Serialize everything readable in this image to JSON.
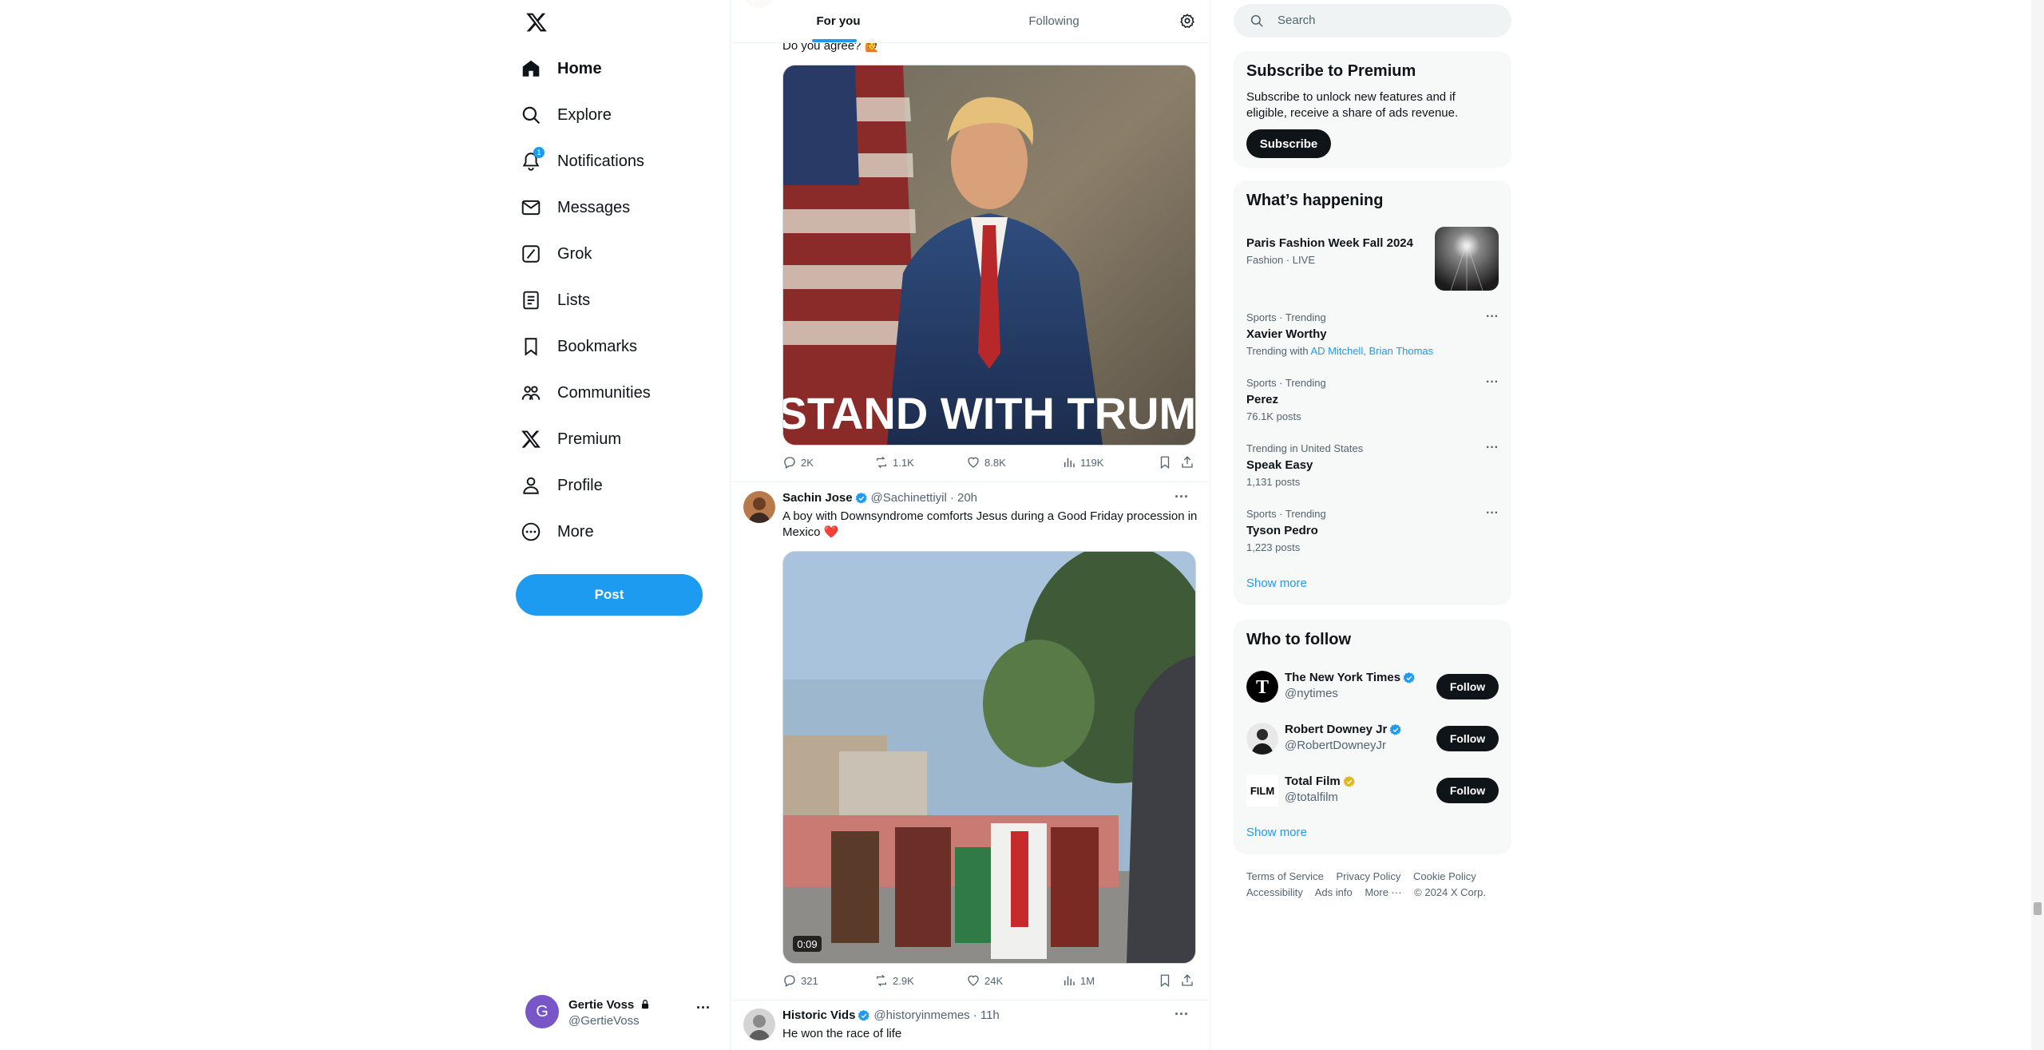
{
  "nav": {
    "items": [
      {
        "label": "Home",
        "icon": "home-icon",
        "active": true
      },
      {
        "label": "Explore",
        "icon": "search-icon"
      },
      {
        "label": "Notifications",
        "icon": "bell-icon",
        "badge": "1"
      },
      {
        "label": "Messages",
        "icon": "envelope-icon"
      },
      {
        "label": "Grok",
        "icon": "grok-icon"
      },
      {
        "label": "Lists",
        "icon": "list-icon"
      },
      {
        "label": "Bookmarks",
        "icon": "bookmark-icon"
      },
      {
        "label": "Communities",
        "icon": "communities-icon"
      },
      {
        "label": "Premium",
        "icon": "x-logo-icon"
      },
      {
        "label": "Profile",
        "icon": "person-icon"
      },
      {
        "label": "More",
        "icon": "more-circle-icon"
      }
    ],
    "post_label": "Post",
    "account": {
      "initial": "G",
      "name": "Gertie Voss",
      "handle": "@GertieVoss",
      "more": "···"
    }
  },
  "timeline": {
    "tabs": [
      {
        "label": "For you"
      },
      {
        "label": "Following"
      }
    ],
    "posts": [
      {
        "text": "Do you agree? 🙋",
        "image_caption": "I STAND WITH TRUMP",
        "stats": {
          "replies": "2K",
          "reposts": "1.1K",
          "likes": "8.8K",
          "views": "119K"
        }
      },
      {
        "name": "Sachin Jose",
        "handle": "@Sachinettiyil",
        "time": "· 20h",
        "text": "A boy with Downsyndrome comforts Jesus during a Good Friday procession in Mexico ❤️",
        "video_duration": "0:09",
        "stats": {
          "replies": "321",
          "reposts": "2.9K",
          "likes": "24K",
          "views": "1M"
        }
      },
      {
        "name": "Historic Vids",
        "handle": "@historyinmemes",
        "time": "· 11h",
        "text": "He won the race of life"
      }
    ]
  },
  "sidebar": {
    "search_placeholder": "Search",
    "premium": {
      "title": "Subscribe to Premium",
      "body": "Subscribe to unlock new features and if eligible, receive a share of ads revenue.",
      "button": "Subscribe"
    },
    "happening": {
      "title": "What’s happening",
      "featured": {
        "name": "Paris Fashion Week Fall 2024",
        "meta": "Fashion · LIVE"
      },
      "trends": [
        {
          "category": "Sports · Trending",
          "name": "Xavier Worthy",
          "extra_prefix": "Trending with",
          "extra_links": [
            "AD Mitchell",
            "Brian Thomas"
          ]
        },
        {
          "category": "Sports · Trending",
          "name": "Perez",
          "count": "76.1K posts"
        },
        {
          "category": "Trending in United States",
          "name": "Speak Easy",
          "count": "1,131 posts"
        },
        {
          "category": "Sports · Trending",
          "name": "Tyson Pedro",
          "count": "1,223 posts"
        }
      ],
      "show_more": "Show more"
    },
    "who_to_follow": {
      "title": "Who to follow",
      "accounts": [
        {
          "name": "The New York Times",
          "handle": "@nytimes",
          "badge": "blue"
        },
        {
          "name": "Robert Downey Jr",
          "handle": "@RobertDowneyJr",
          "badge": "blue"
        },
        {
          "name": "Total Film",
          "handle": "@totalfilm",
          "badge": "gold",
          "logo_text": "FILM"
        }
      ],
      "follow_label": "Follow",
      "show_more": "Show more"
    },
    "footer": {
      "row1": [
        "Terms of Service",
        "Privacy Policy",
        "Cookie Policy"
      ],
      "row2": [
        "Accessibility",
        "Ads info",
        "More ···",
        "© 2024 X Corp."
      ]
    }
  },
  "colors": {
    "accent": "#1d9bf0",
    "text": "#0f1419",
    "muted": "#536471",
    "gold": "#e2b719"
  }
}
